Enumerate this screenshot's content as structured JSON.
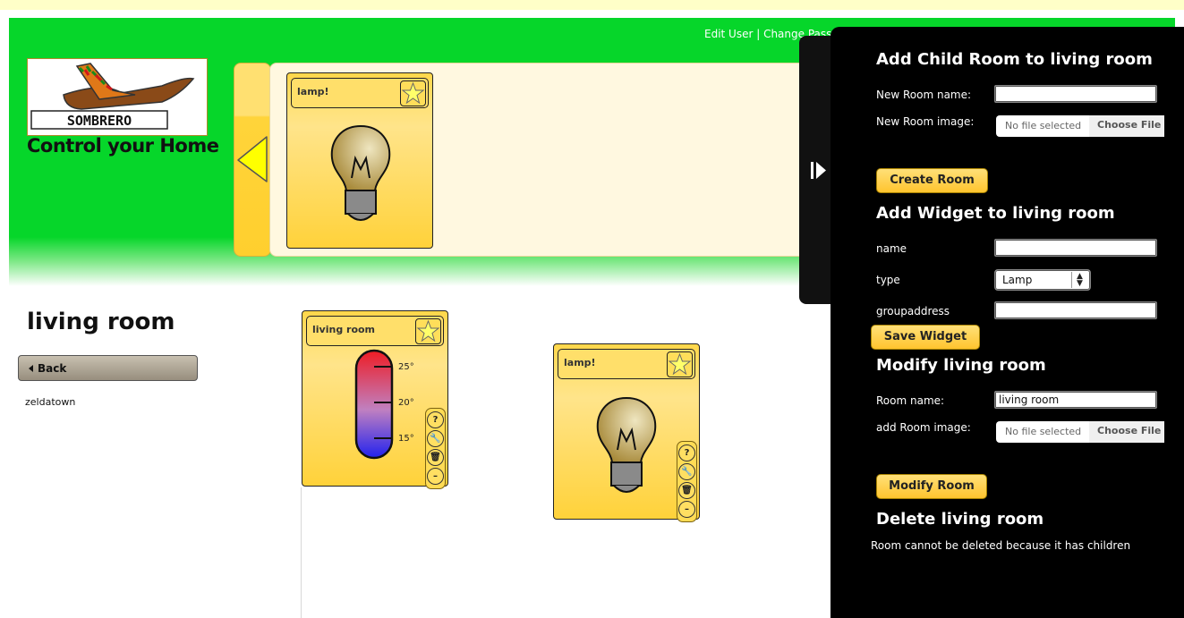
{
  "header": {
    "user_links": "Edit User | Change Passw",
    "logo_text": "SOMBRERO",
    "tagline": "Control your Home"
  },
  "favorites": {
    "widgets": [
      {
        "title": "lamp!",
        "icon": "lightbulb-icon"
      }
    ]
  },
  "room": {
    "name": "living room",
    "back_label": "Back",
    "children": [
      "zeldatown"
    ]
  },
  "widgets": [
    {
      "title": "living room",
      "type": "thermometer",
      "ticks": [
        "25°",
        "20°",
        "15°"
      ]
    },
    {
      "title": "lamp!",
      "type": "lamp"
    }
  ],
  "tools": [
    "?",
    "wrench-icon",
    "trash-icon",
    "minus-icon"
  ],
  "panel": {
    "add_child": {
      "heading": "Add Child Room to living room",
      "name_label": "New Room name:",
      "name_value": "",
      "image_label": "New Room image:",
      "file_none": "No file selected",
      "file_button": "Choose File",
      "submit": "Create Room"
    },
    "add_widget": {
      "heading": "Add Widget to living room",
      "name_label": "name",
      "name_value": "",
      "type_label": "type",
      "type_value": "Lamp",
      "group_label": "groupaddress",
      "group_value": "",
      "submit": "Save Widget"
    },
    "modify": {
      "heading": "Modify living room",
      "name_label": "Room name:",
      "name_value": "living room",
      "image_label": "add Room image:",
      "file_none": "No file selected",
      "file_button": "Choose File",
      "submit": "Modify Room"
    },
    "delete": {
      "heading": "Delete living room",
      "note": "Room cannot be deleted because it has children"
    }
  },
  "colors": {
    "header_green": "#06d62a",
    "widget_yellow": "#ffd74a",
    "panel_bg": "#000000"
  }
}
